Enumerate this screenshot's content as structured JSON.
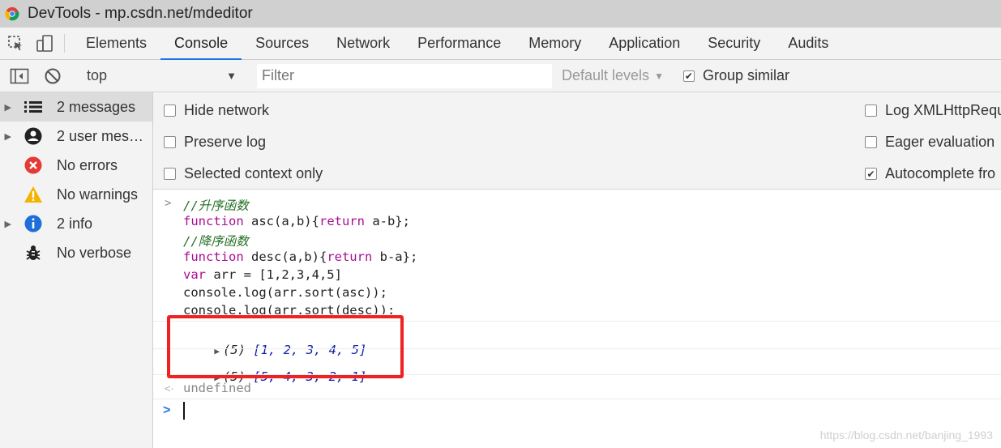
{
  "window": {
    "title": "DevTools - mp.csdn.net/mdeditor"
  },
  "tabs": [
    "Elements",
    "Console",
    "Sources",
    "Network",
    "Performance",
    "Memory",
    "Application",
    "Security",
    "Audits"
  ],
  "toolbar": {
    "context": "top",
    "filter_placeholder": "Filter",
    "levels": "Default levels",
    "group_similar": "Group similar"
  },
  "sidebar": {
    "items": [
      {
        "label": "2 messages",
        "icon": "list-icon"
      },
      {
        "label": "2 user mess…",
        "icon": "user-icon"
      },
      {
        "label": "No errors",
        "icon": "error-icon"
      },
      {
        "label": "No warnings",
        "icon": "warning-icon"
      },
      {
        "label": "2 info",
        "icon": "info-icon"
      },
      {
        "label": "No verbose",
        "icon": "bug-icon"
      }
    ]
  },
  "settings": {
    "hide_network": "Hide network",
    "preserve_log": "Preserve log",
    "selected_context": "Selected context only",
    "log_xhr": "Log XMLHttpRequ",
    "eager_eval": "Eager evaluation",
    "autocomplete": "Autocomplete fro"
  },
  "console": {
    "code": {
      "c1": "//升序函数",
      "l2_kw": "function",
      "l2_rest": " asc(a,b){",
      "l2_ret": "return",
      "l2_end": " a-b};",
      "c3": "//降序函数",
      "l4_kw": "function",
      "l4_rest": " desc(a,b){",
      "l4_ret": "return",
      "l4_end": " b-a};",
      "l5_kw": "var",
      "l5_rest": " arr = [1,2,3,4,5]",
      "l6": "console.log(arr.sort(asc));",
      "l7": "console.log(arr.sort(desc));"
    },
    "outputs": [
      {
        "count": "(5)",
        "value": "[1, 2, 3, 4, 5]"
      },
      {
        "count": "(5)",
        "value": "[5, 4, 3, 2, 1]"
      }
    ],
    "return_value": "undefined"
  },
  "watermark": "https://blog.csdn.net/banjing_1993"
}
